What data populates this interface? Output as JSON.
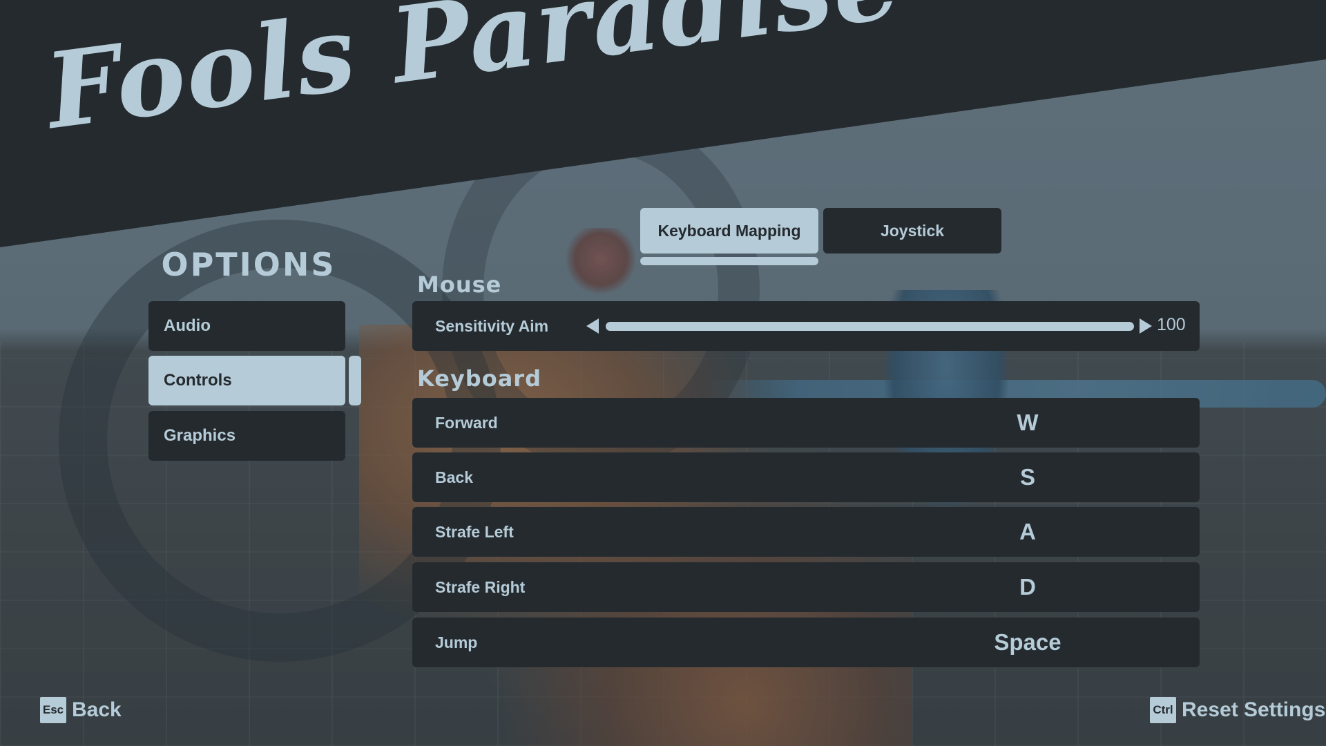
{
  "game": {
    "title": "Fools Paradise"
  },
  "menu": {
    "heading": "OPTIONS",
    "items": [
      {
        "label": "Audio",
        "active": false
      },
      {
        "label": "Controls",
        "active": true
      },
      {
        "label": "Graphics",
        "active": false
      }
    ]
  },
  "tabs": [
    {
      "label": "Keyboard Mapping",
      "active": true
    },
    {
      "label": "Joystick",
      "active": false
    }
  ],
  "mouse": {
    "heading": "Mouse",
    "sensitivity": {
      "label": "Sensitivity Aim",
      "value": "100",
      "fraction": 1.0
    }
  },
  "keyboard": {
    "heading": "Keyboard",
    "bindings": [
      {
        "action": "Forward",
        "key": "W"
      },
      {
        "action": "Back",
        "key": "S"
      },
      {
        "action": "Strafe Left",
        "key": "A"
      },
      {
        "action": "Strafe Right",
        "key": "D"
      },
      {
        "action": "Jump",
        "key": "Space"
      }
    ]
  },
  "footer": {
    "back": {
      "key": "Esc",
      "label": "Back"
    },
    "reset": {
      "key": "Ctrl",
      "label": "Reset Settings"
    }
  },
  "colors": {
    "accent": "#b5ccd8",
    "panel": "#252a2f"
  }
}
